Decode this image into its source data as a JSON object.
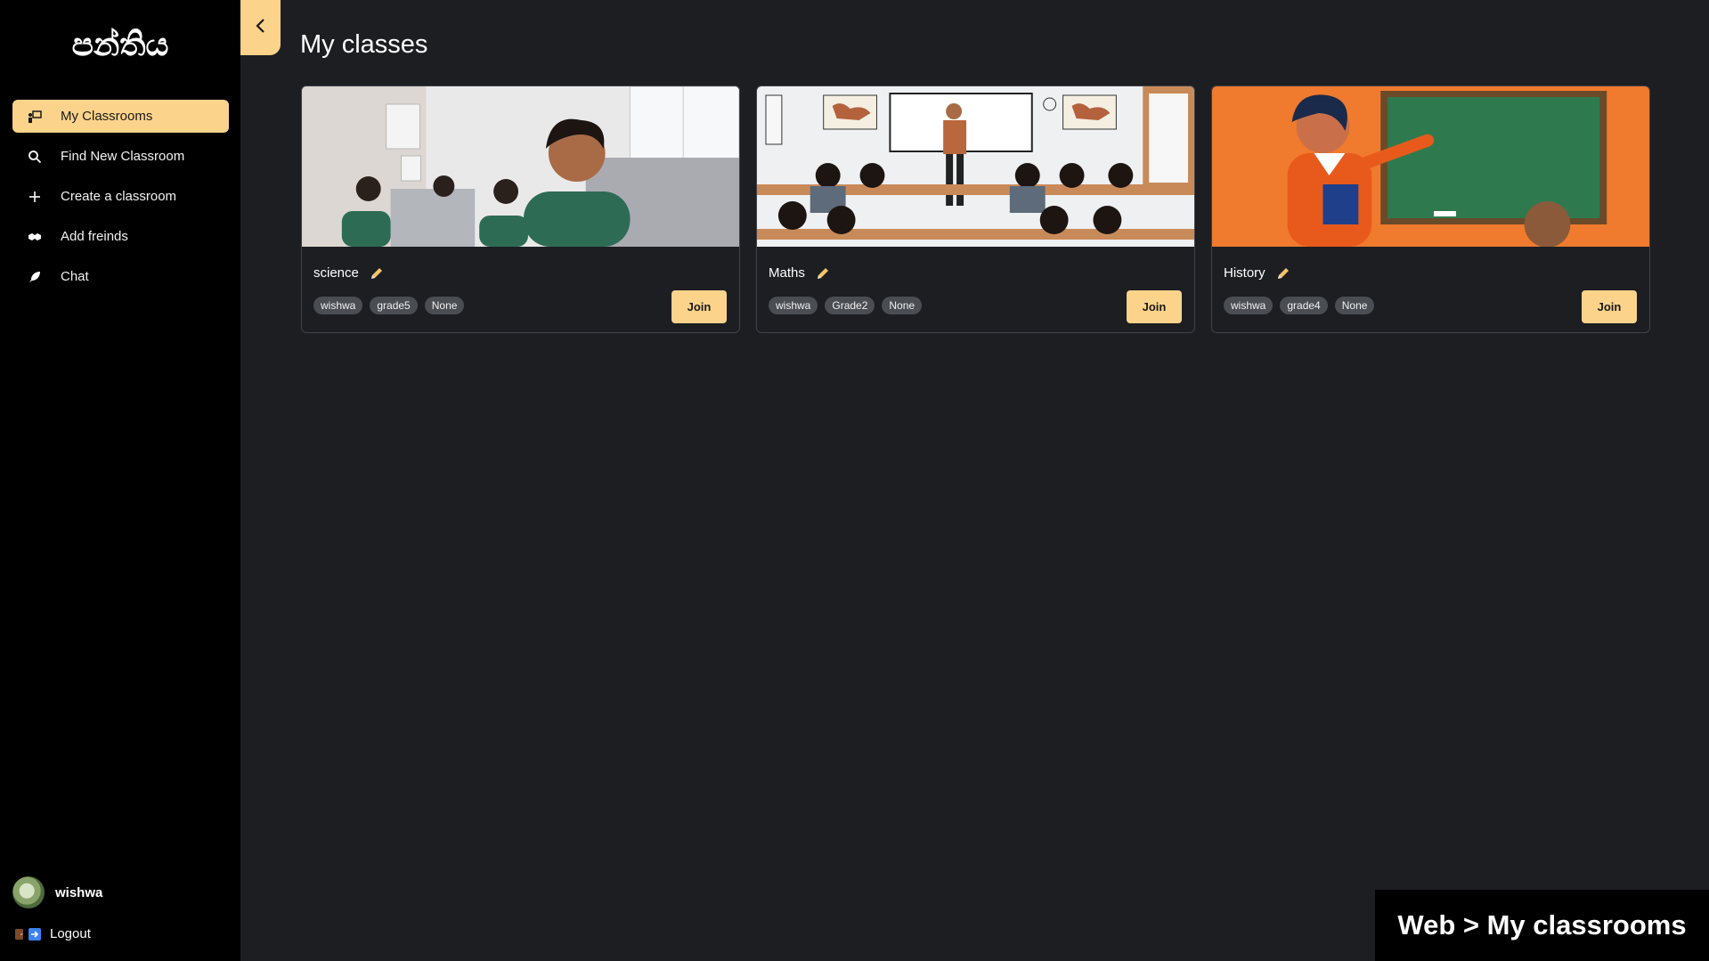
{
  "app": {
    "logo_text": "පන්තිය"
  },
  "sidebar": {
    "items": [
      {
        "label": "My Classrooms",
        "icon": "classroom-icon",
        "active": true
      },
      {
        "label": "Find New Classroom",
        "icon": "search-icon"
      },
      {
        "label": "Create a classroom",
        "icon": "plus-icon"
      },
      {
        "label": "Add freinds",
        "icon": "handshake-icon"
      },
      {
        "label": "Chat",
        "icon": "feather-icon"
      }
    ],
    "user": {
      "name": "wishwa"
    },
    "logout_label": "Logout"
  },
  "main": {
    "title": "My classes",
    "classes": [
      {
        "name": "science",
        "tags": [
          "wishwa",
          "grade5",
          "None"
        ],
        "join_label": "Join"
      },
      {
        "name": "Maths",
        "tags": [
          "wishwa",
          "Grade2",
          "None"
        ],
        "join_label": "Join"
      },
      {
        "name": "History",
        "tags": [
          "wishwa",
          "grade4",
          "None"
        ],
        "join_label": "Join"
      }
    ]
  },
  "caption": "Web > My classrooms",
  "colors": {
    "accent": "#fcd38a",
    "sidebar_bg": "#000000",
    "main_bg": "#1c1e22",
    "tag_bg": "#4a4d52"
  }
}
